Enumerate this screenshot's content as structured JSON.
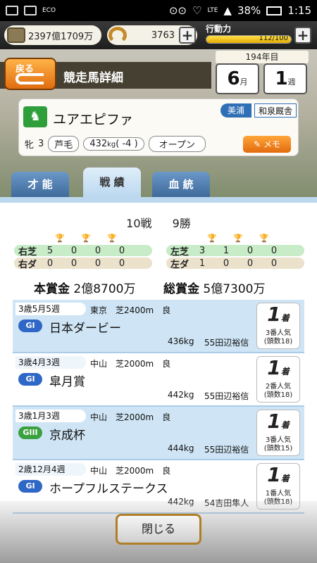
{
  "status": {
    "eco": "ECO",
    "lte": "LTE",
    "battery": "38%",
    "time": "1:15"
  },
  "resources": {
    "money": "2397億1709万",
    "horseshoes": "3763",
    "stamina_label": "行動力",
    "stamina_text": "112/100",
    "stamina_level": 1.0,
    "plus": "+"
  },
  "header": {
    "back_label": "戻る",
    "title": "競走馬詳細",
    "year": "194年目",
    "month": "6",
    "month_unit": "月",
    "week": "1",
    "week_unit": "週"
  },
  "horse": {
    "name": "ユアエピファ",
    "region": "美浦",
    "stable": "和泉厩舎",
    "sex": "牝",
    "age": "3",
    "coat": "芦毛",
    "weight": "432",
    "weight_unit": "kg",
    "weight_diff": "( -4 )",
    "class": "オープン",
    "memo_label": "メモ"
  },
  "tabs": [
    "才 能",
    "戦 績",
    "血 統"
  ],
  "summary": {
    "races": "10戦",
    "wins": "9勝"
  },
  "stats": {
    "right_turf": {
      "label": "右芝",
      "values": [
        "5",
        "0",
        "0",
        "0"
      ]
    },
    "right_dirt": {
      "label": "右ダ",
      "values": [
        "0",
        "0",
        "0",
        "0"
      ]
    },
    "left_turf": {
      "label": "左芝",
      "values": [
        "3",
        "1",
        "0",
        "0"
      ]
    },
    "left_dirt": {
      "label": "左ダ",
      "values": [
        "1",
        "0",
        "0",
        "0"
      ]
    }
  },
  "prize": {
    "main_label": "本賞金",
    "main_value": "2億8700万",
    "total_label": "総賞金",
    "total_value": "5億7300万"
  },
  "races": [
    {
      "date": "3歳5月5週",
      "venue": "東京　芝2400m　良",
      "grade": "GI",
      "name": "日本ダービー",
      "weight": "436kg",
      "jockey": "55田辺裕信",
      "pos": "1",
      "pos_unit": "着",
      "pop1": "3番人気",
      "pop2": "(頭数18)"
    },
    {
      "date": "3歳4月3週",
      "venue": "中山　芝2000m　良",
      "grade": "GI",
      "name": "皐月賞",
      "weight": "442kg",
      "jockey": "55田辺裕信",
      "pos": "1",
      "pos_unit": "着",
      "pop1": "2番人気",
      "pop2": "(頭数18)"
    },
    {
      "date": "3歳1月3週",
      "venue": "中山　芝2000m　良",
      "grade": "GIII",
      "name": "京成杯",
      "weight": "444kg",
      "jockey": "55田辺裕信",
      "pos": "1",
      "pos_unit": "着",
      "pop1": "3番人気",
      "pop2": "(頭数15)"
    },
    {
      "date": "2歳12月4週",
      "venue": "中山　芝2000m　良",
      "grade": "GI",
      "name": "ホープフルステークス",
      "weight": "442kg",
      "jockey": "54吉田隼人",
      "pos": "1",
      "pos_unit": "着",
      "pop1": "1番人気",
      "pop2": "(頭数18)"
    }
  ],
  "close_label": "閉じる"
}
